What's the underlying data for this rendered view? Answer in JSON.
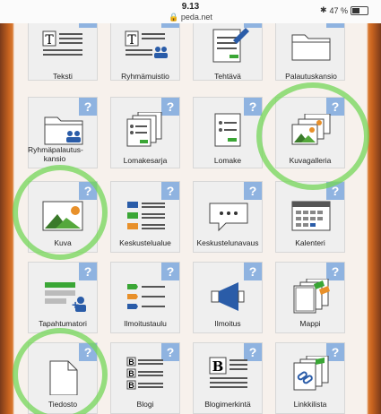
{
  "status_bar": {
    "time": "9.13",
    "url": "peda.net",
    "battery": "47 %"
  },
  "tiles": [
    {
      "label": "Teksti"
    },
    {
      "label": "Ryhmämuistio"
    },
    {
      "label": "Tehtävä"
    },
    {
      "label": "Palautuskansio"
    },
    {
      "label": "Ryhmäpalautus-\nkansio"
    },
    {
      "label": "Lomakesarja"
    },
    {
      "label": "Lomake"
    },
    {
      "label": "Kuvagalleria"
    },
    {
      "label": "Kuva"
    },
    {
      "label": "Keskustelualue"
    },
    {
      "label": "Keskustelunavaus"
    },
    {
      "label": "Kalenteri"
    },
    {
      "label": "Tapahtumatori"
    },
    {
      "label": "Ilmoitustaulu"
    },
    {
      "label": "Ilmoitus"
    },
    {
      "label": "Mappi"
    },
    {
      "label": "Tiedosto"
    },
    {
      "label": "Blogi"
    },
    {
      "label": "Blogimerkintä"
    },
    {
      "label": "Linkkilista"
    }
  ],
  "help_badge": "?",
  "colors": {
    "badge": "#8fb3e0",
    "highlight": "#74d658",
    "accent_orange": "#e8902a"
  }
}
